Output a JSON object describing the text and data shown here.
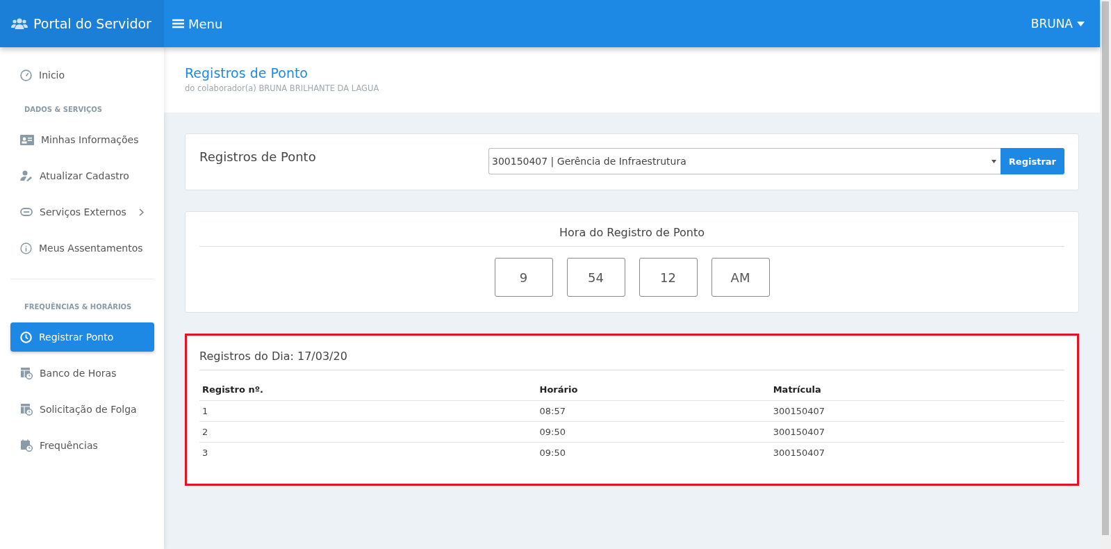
{
  "topbar": {
    "brand": "Portal do Servidor",
    "menu": "Menu",
    "user": "BRUNA"
  },
  "sidebar": {
    "items": [
      {
        "kind": "link",
        "label": "Inicio",
        "selected": false
      },
      {
        "kind": "heading",
        "label": "DADOS & SERVIÇOS"
      },
      {
        "kind": "link",
        "label": "Minhas Informações",
        "selected": false
      },
      {
        "kind": "link",
        "label": "Atualizar Cadastro",
        "selected": false
      },
      {
        "kind": "link",
        "label": "Serviços Externos",
        "selected": false,
        "submenu": true
      },
      {
        "kind": "link",
        "label": "Meus Assentamentos",
        "selected": false
      },
      {
        "kind": "divider"
      },
      {
        "kind": "heading",
        "label": "FREQUÊNCIAS & HORÁRIOS"
      },
      {
        "kind": "link",
        "label": "Registrar Ponto",
        "selected": true
      },
      {
        "kind": "link",
        "label": "Banco de Horas",
        "selected": false
      },
      {
        "kind": "link",
        "label": "Solicitação de Folga",
        "selected": false
      },
      {
        "kind": "link",
        "label": "Frequências",
        "selected": false
      }
    ]
  },
  "header": {
    "title": "Registros de Ponto",
    "subtitle": "do colaborador(a) BRUNA BRILHANTE DA LAGUA"
  },
  "register_card": {
    "title": "Registros de Ponto",
    "select_value": "300150407 | Gerência de Infraestrutura",
    "button": "Registrar"
  },
  "clock_card": {
    "title": "Hora do Registro de Ponto",
    "fields": [
      "9",
      "54",
      "12",
      "AM"
    ]
  },
  "day_card": {
    "title": "Registros do Dia: 17/03/20",
    "highlighted": true,
    "columns": [
      "Registro nº.",
      "Horário",
      "Matrícula"
    ],
    "rows": [
      [
        "1",
        "08:57",
        "300150407"
      ],
      [
        "2",
        "09:50",
        "300150407"
      ],
      [
        "3",
        "09:50",
        "300150407"
      ]
    ]
  }
}
